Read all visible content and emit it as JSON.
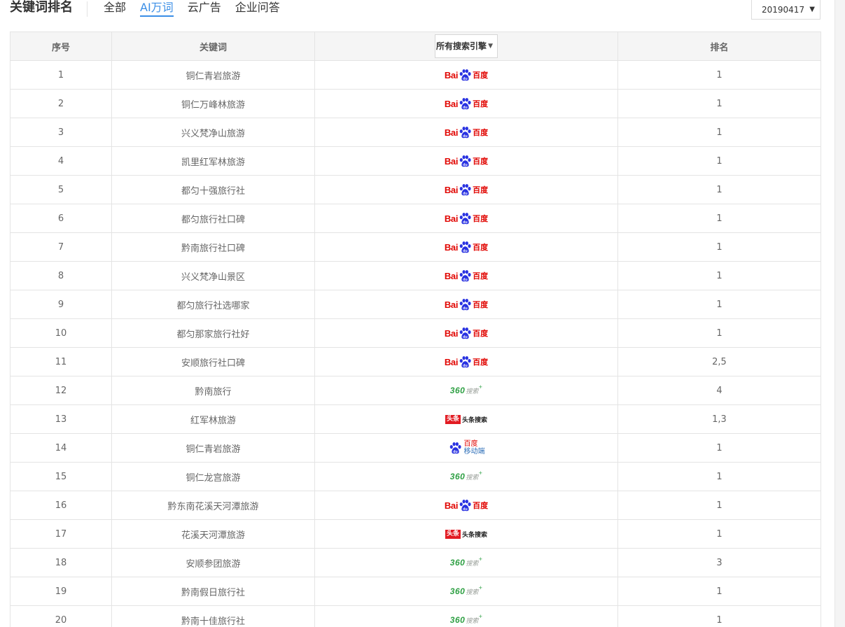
{
  "header": {
    "title": "关键词排名",
    "tabs": [
      {
        "label": "全部",
        "active": false
      },
      {
        "label": "AI万词",
        "active": true
      },
      {
        "label": "云广告",
        "active": false
      },
      {
        "label": "企业问答",
        "active": false
      }
    ],
    "date_select": {
      "value": "20190417",
      "icon": "caret-down-icon"
    }
  },
  "table": {
    "columns": {
      "index": "序号",
      "keyword": "关键词",
      "engine_filter": "所有搜索引擎",
      "rank": "排名"
    },
    "engine_labels": {
      "baidu": {
        "latin": "Bai",
        "cn": "百度",
        "icon": "baidu-paw-icon"
      },
      "s360": {
        "num": "360",
        "txt": "搜索",
        "plus": "+"
      },
      "toutiao": {
        "badge": "头条",
        "txt": "头条搜索"
      },
      "baidu_mobile": {
        "l1": "百度",
        "l2": "移动端",
        "icon": "baidu-paw-icon"
      }
    },
    "colors": {
      "baidu_red": "#e10602",
      "baidu_blue": "#2932e1",
      "s360_green": "#2fa044",
      "toutiao_red": "#e21b22",
      "active_tab": "#3a8ee6"
    },
    "rows": [
      {
        "index": "1",
        "keyword": "铜仁青岩旅游",
        "engine": "baidu",
        "rank": "1"
      },
      {
        "index": "2",
        "keyword": "铜仁万峰林旅游",
        "engine": "baidu",
        "rank": "1"
      },
      {
        "index": "3",
        "keyword": "兴义梵净山旅游",
        "engine": "baidu",
        "rank": "1"
      },
      {
        "index": "4",
        "keyword": "凯里红军林旅游",
        "engine": "baidu",
        "rank": "1"
      },
      {
        "index": "5",
        "keyword": "都匀十强旅行社",
        "engine": "baidu",
        "rank": "1"
      },
      {
        "index": "6",
        "keyword": "都匀旅行社口碑",
        "engine": "baidu",
        "rank": "1"
      },
      {
        "index": "7",
        "keyword": "黔南旅行社口碑",
        "engine": "baidu",
        "rank": "1"
      },
      {
        "index": "8",
        "keyword": "兴义梵净山景区",
        "engine": "baidu",
        "rank": "1"
      },
      {
        "index": "9",
        "keyword": "都匀旅行社选哪家",
        "engine": "baidu",
        "rank": "1"
      },
      {
        "index": "10",
        "keyword": "都匀那家旅行社好",
        "engine": "baidu",
        "rank": "1"
      },
      {
        "index": "11",
        "keyword": "安顺旅行社口碑",
        "engine": "baidu",
        "rank": "2,5"
      },
      {
        "index": "12",
        "keyword": "黔南旅行",
        "engine": "s360",
        "rank": "4"
      },
      {
        "index": "13",
        "keyword": "红军林旅游",
        "engine": "toutiao",
        "rank": "1,3"
      },
      {
        "index": "14",
        "keyword": "铜仁青岩旅游",
        "engine": "baidu_mobile",
        "rank": "1"
      },
      {
        "index": "15",
        "keyword": "铜仁龙宫旅游",
        "engine": "s360",
        "rank": "1"
      },
      {
        "index": "16",
        "keyword": "黔东南花溪天河潭旅游",
        "engine": "baidu",
        "rank": "1"
      },
      {
        "index": "17",
        "keyword": "花溪天河潭旅游",
        "engine": "toutiao",
        "rank": "1"
      },
      {
        "index": "18",
        "keyword": "安顺参团旅游",
        "engine": "s360",
        "rank": "3"
      },
      {
        "index": "19",
        "keyword": "黔南假日旅行社",
        "engine": "s360",
        "rank": "1"
      },
      {
        "index": "20",
        "keyword": "黔南十佳旅行社",
        "engine": "s360",
        "rank": "1"
      }
    ]
  }
}
